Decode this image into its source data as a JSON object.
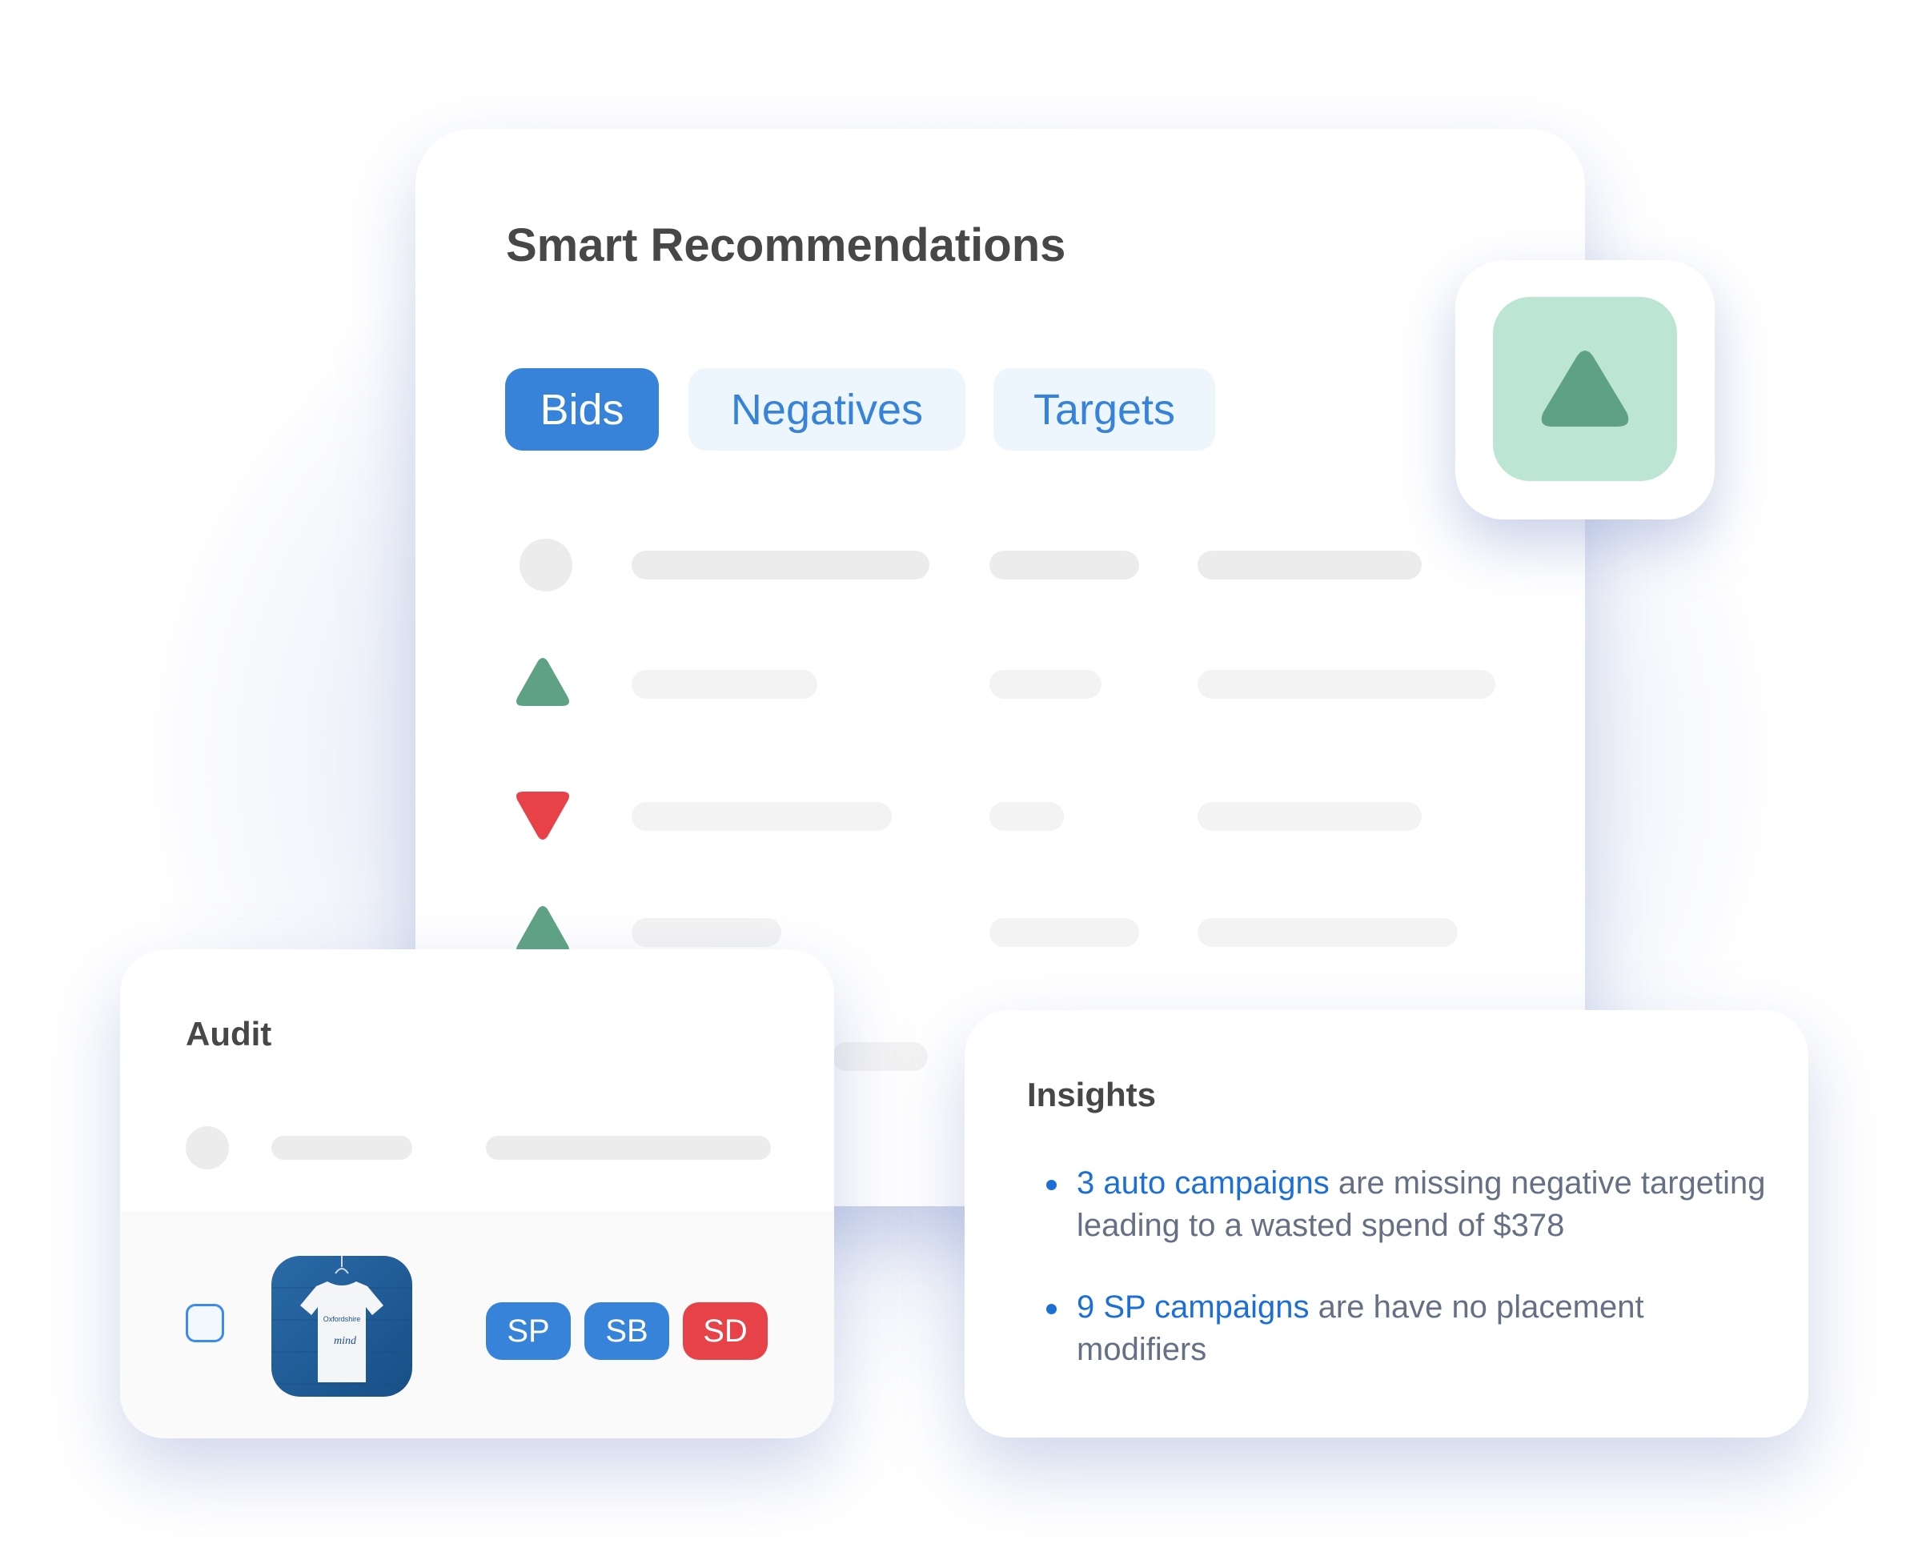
{
  "recommendations": {
    "title": "Smart Recommendations",
    "tabs": [
      {
        "label": "Bids",
        "active": true
      },
      {
        "label": "Negatives",
        "active": false
      },
      {
        "label": "Targets",
        "active": false
      }
    ],
    "rows": [
      {
        "indicator": "placeholder-dot"
      },
      {
        "indicator": "trend-up-icon"
      },
      {
        "indicator": "trend-down-icon"
      },
      {
        "indicator": "trend-up-icon"
      },
      {
        "indicator": "none"
      }
    ],
    "highlight_icon": "trend-up-icon"
  },
  "audit": {
    "title": "Audit",
    "product_image": "t-shirt-product-thumbnail",
    "badges": [
      {
        "label": "SP",
        "color": "#3683d9"
      },
      {
        "label": "SB",
        "color": "#3683d9"
      },
      {
        "label": "SD",
        "color": "#e84249"
      }
    ]
  },
  "insights": {
    "title": "Insights",
    "items": [
      {
        "highlight": "3 auto campaigns",
        "text": " are missing negative targeting leading to a wasted spend of $378"
      },
      {
        "highlight": "9 SP campaigns",
        "text": " are have no placement modifiers"
      }
    ]
  },
  "colors": {
    "accent_blue": "#3683d9",
    "up_green": "#5fa283",
    "down_red": "#e84249",
    "green_tint": "#bde5d3"
  }
}
